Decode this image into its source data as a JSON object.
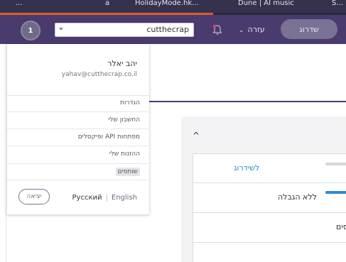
{
  "browser": {
    "bookmark_partial_1": "...",
    "bookmark_partial_2": "a",
    "bookmark_partial_3": "HolidayMode.hk...",
    "bookmark_partial_4": "Dune | AI music",
    "bookmark_partial_5": "S..."
  },
  "header": {
    "avatar_initial": "1",
    "search_value": "cutthecrap",
    "help_label": "עזרה",
    "upgrade_label": "שדרוג"
  },
  "user_menu": {
    "name": "יהב יאלר",
    "email": "yahav@cutthecrap.co.il",
    "items": [
      {
        "label": "הגדרות"
      },
      {
        "label": "החשבון שלי"
      },
      {
        "label": "מפתחות API ופיקסלים"
      },
      {
        "label": "ההזנות שלי"
      },
      {
        "label": "שותפים"
      }
    ],
    "lang_english": "English",
    "lang_russian": "Русский",
    "logout_label": "יציאה"
  },
  "main": {
    "card_upgrade_link": "לשידרוג",
    "card_unlimited": "ללא הגבלה",
    "card_partial": "סים"
  },
  "colors": {
    "header_bg": "#4a3b6e",
    "accent_blue": "#2f8ad1",
    "orange": "#e05a2a"
  }
}
